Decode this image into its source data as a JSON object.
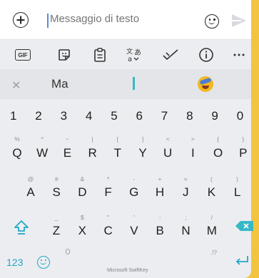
{
  "compose": {
    "placeholder": "Messaggio di testo"
  },
  "toolbar": {
    "gif_label": "GIF"
  },
  "suggestions": {
    "word": "Ma"
  },
  "keyboard": {
    "numbers": [
      "1",
      "2",
      "3",
      "4",
      "5",
      "6",
      "7",
      "8",
      "9",
      "0"
    ],
    "row1": [
      {
        "key": "Q",
        "hint": "%"
      },
      {
        "key": "W",
        "hint": "^"
      },
      {
        "key": "E",
        "hint": "~"
      },
      {
        "key": "R",
        "hint": "|"
      },
      {
        "key": "T",
        "hint": "["
      },
      {
        "key": "Y",
        "hint": "]"
      },
      {
        "key": "U",
        "hint": "<"
      },
      {
        "key": "I",
        "hint": ">"
      },
      {
        "key": "O",
        "hint": "{"
      },
      {
        "key": "P",
        "hint": "}"
      }
    ],
    "row2": [
      {
        "key": "A",
        "hint": "@"
      },
      {
        "key": "S",
        "hint": "#"
      },
      {
        "key": "D",
        "hint": "&"
      },
      {
        "key": "F",
        "hint": "*"
      },
      {
        "key": "G",
        "hint": "-"
      },
      {
        "key": "H",
        "hint": "+"
      },
      {
        "key": "J",
        "hint": "="
      },
      {
        "key": "K",
        "hint": "("
      },
      {
        "key": "L",
        "hint": ")"
      }
    ],
    "row3": [
      {
        "key": "Z",
        "hint": "_"
      },
      {
        "key": "X",
        "hint": "$"
      },
      {
        "key": "C",
        "hint": "\""
      },
      {
        "key": "V",
        "hint": "'"
      },
      {
        "key": "B",
        "hint": ":"
      },
      {
        "key": "N",
        "hint": ";"
      },
      {
        "key": "M",
        "hint": "/"
      }
    ],
    "num_toggle_label": "123",
    "space_label": "Microsoft SwiftKey",
    "punct_hint": ".!?"
  },
  "colors": {
    "accent": "#23a7c8",
    "backspace": "#35b9c6",
    "border": "#f3c43f"
  }
}
